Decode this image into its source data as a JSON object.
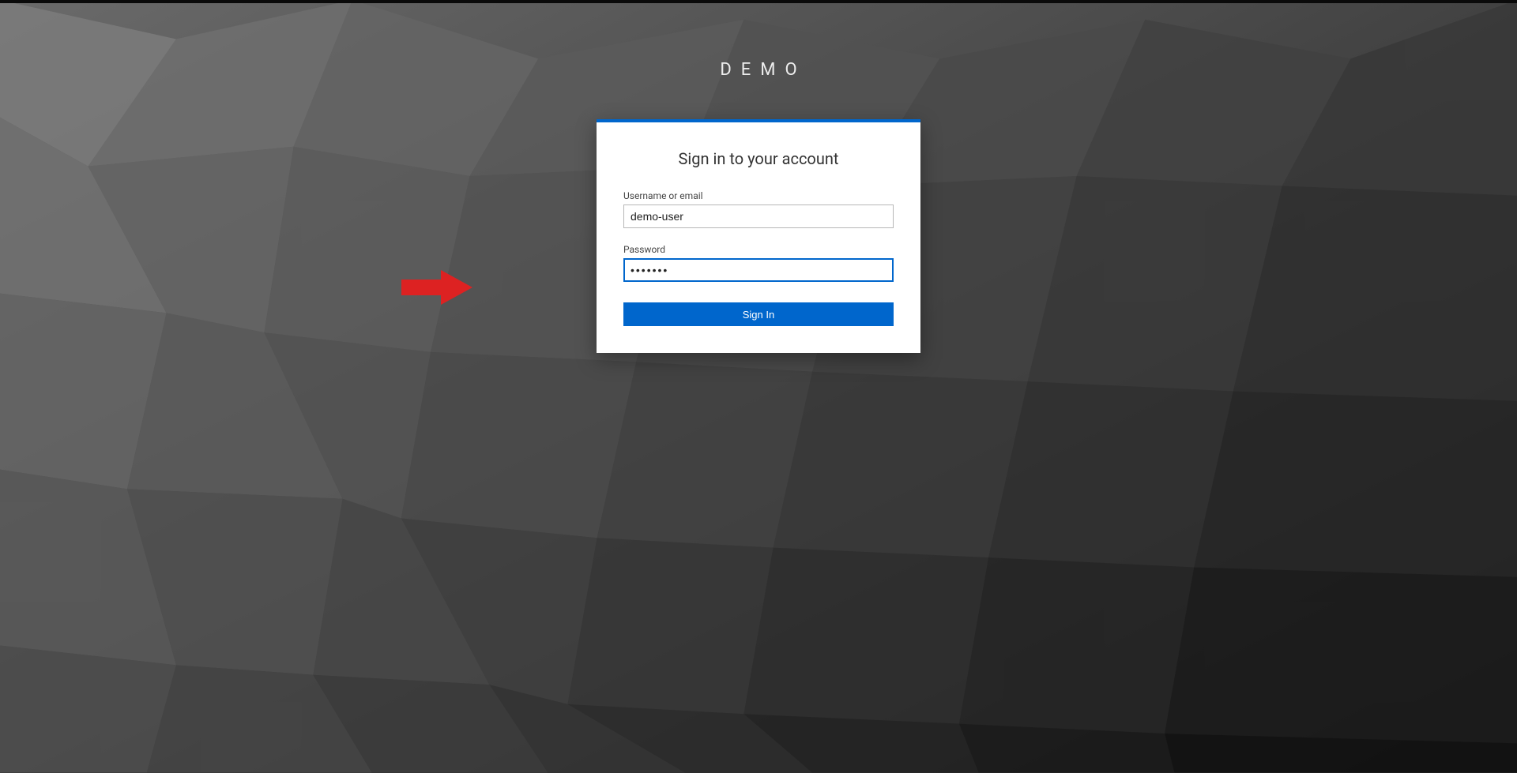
{
  "brand": "DEMO",
  "card": {
    "title": "Sign in to your account",
    "username": {
      "label": "Username or email",
      "value": "demo-user"
    },
    "password": {
      "label": "Password",
      "value": "•••••••"
    },
    "submit_label": "Sign In"
  },
  "colors": {
    "accent": "#0066cc",
    "arrow": "#dd2222"
  }
}
